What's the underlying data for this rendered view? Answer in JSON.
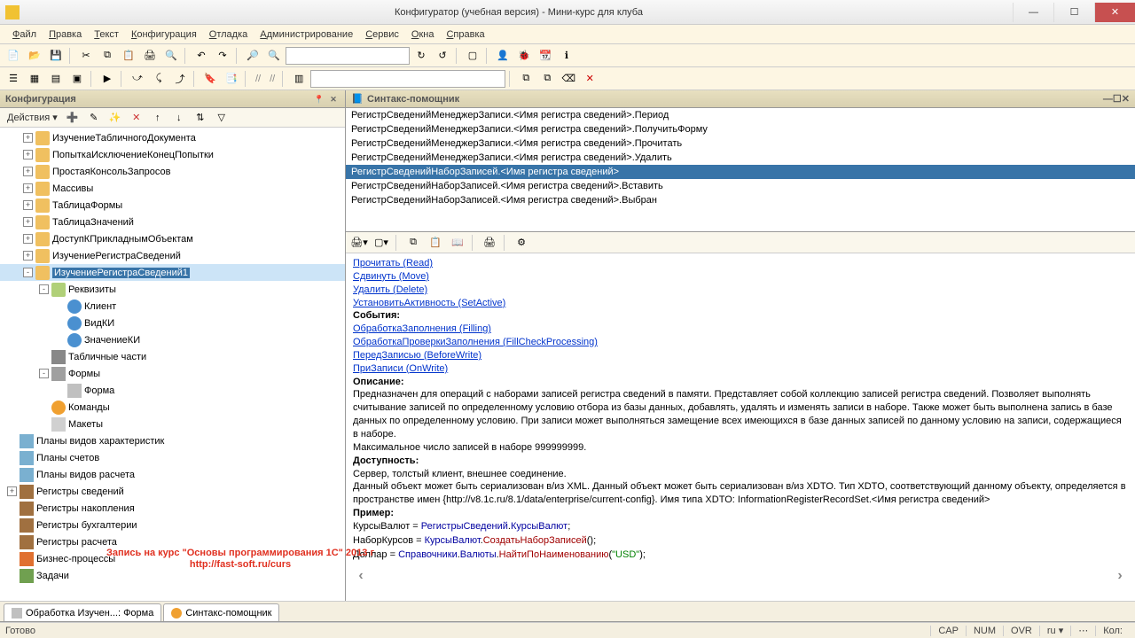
{
  "window": {
    "title": "Конфигуратор (учебная версия) - Мини-курс для клуба"
  },
  "menu": [
    "Файл",
    "Правка",
    "Текст",
    "Конфигурация",
    "Отладка",
    "Администрирование",
    "Сервис",
    "Окна",
    "Справка"
  ],
  "sidebar": {
    "header": "Конфигурация",
    "actions_label": "Действия",
    "tree": [
      {
        "l": 1,
        "exp": "+",
        "ic": "ic-proc",
        "label": "ИзучениеТабличногоДокумента"
      },
      {
        "l": 1,
        "exp": "+",
        "ic": "ic-proc",
        "label": "ПопыткаИсключениеКонецПопытки"
      },
      {
        "l": 1,
        "exp": "+",
        "ic": "ic-proc",
        "label": "ПростаяКонсольЗапросов"
      },
      {
        "l": 1,
        "exp": "+",
        "ic": "ic-proc",
        "label": "Массивы"
      },
      {
        "l": 1,
        "exp": "+",
        "ic": "ic-proc",
        "label": "ТаблицаФормы"
      },
      {
        "l": 1,
        "exp": "+",
        "ic": "ic-proc",
        "label": "ТаблицаЗначений"
      },
      {
        "l": 1,
        "exp": "+",
        "ic": "ic-proc",
        "label": "ДоступКПрикладнымОбъектам"
      },
      {
        "l": 1,
        "exp": "+",
        "ic": "ic-proc",
        "label": "ИзучениеРегистраСведений"
      },
      {
        "l": 1,
        "exp": "-",
        "ic": "ic-proc",
        "label": "ИзучениеРегистраСведений1",
        "sel": true
      },
      {
        "l": 2,
        "exp": "-",
        "ic": "ic-attr",
        "label": "Реквизиты"
      },
      {
        "l": 3,
        "exp": "",
        "ic": "ic-attr-item",
        "label": "Клиент"
      },
      {
        "l": 3,
        "exp": "",
        "ic": "ic-attr-item",
        "label": "ВидКИ"
      },
      {
        "l": 3,
        "exp": "",
        "ic": "ic-attr-item",
        "label": "ЗначениеКИ"
      },
      {
        "l": 2,
        "exp": "",
        "ic": "ic-tab",
        "label": "Табличные части"
      },
      {
        "l": 2,
        "exp": "-",
        "ic": "ic-form",
        "label": "Формы"
      },
      {
        "l": 3,
        "exp": "",
        "ic": "ic-form-item",
        "label": "Форма"
      },
      {
        "l": 2,
        "exp": "",
        "ic": "ic-cmd",
        "label": "Команды"
      },
      {
        "l": 2,
        "exp": "",
        "ic": "ic-tmpl",
        "label": "Макеты"
      },
      {
        "l": 0,
        "exp": "",
        "ic": "ic-plan",
        "label": "Планы видов характеристик"
      },
      {
        "l": 0,
        "exp": "",
        "ic": "ic-plan",
        "label": "Планы счетов"
      },
      {
        "l": 0,
        "exp": "",
        "ic": "ic-plan",
        "label": "Планы видов расчета"
      },
      {
        "l": 0,
        "exp": "+",
        "ic": "ic-reg",
        "label": "Регистры сведений"
      },
      {
        "l": 0,
        "exp": "",
        "ic": "ic-reg",
        "label": "Регистры накопления"
      },
      {
        "l": 0,
        "exp": "",
        "ic": "ic-reg",
        "label": "Регистры бухгалтерии"
      },
      {
        "l": 0,
        "exp": "",
        "ic": "ic-reg",
        "label": "Регистры расчета"
      },
      {
        "l": 0,
        "exp": "",
        "ic": "ic-biz",
        "label": "Бизнес-процессы"
      },
      {
        "l": 0,
        "exp": "",
        "ic": "ic-task",
        "label": "Задачи"
      }
    ]
  },
  "syntax": {
    "header": "Синтакс-помощник",
    "rows": [
      "РегистрСведенийМенеджерЗаписи.<Имя регистра сведений>.Период",
      "РегистрСведенийМенеджерЗаписи.<Имя регистра сведений>.ПолучитьФорму",
      "РегистрСведенийМенеджерЗаписи.<Имя регистра сведений>.Прочитать",
      "РегистрСведенийМенеджерЗаписи.<Имя регистра сведений>.Удалить",
      "РегистрСведенийНаборЗаписей.<Имя регистра сведений>",
      "РегистрСведенийНаборЗаписей.<Имя регистра сведений>.Вставить",
      "РегистрСведенийНаборЗаписей.<Имя регистра сведений>.Выбран"
    ],
    "selected": 4
  },
  "help": {
    "links1": [
      "Прочитать (Read)",
      "Сдвинуть (Move)",
      "Удалить (Delete)",
      "УстановитьАктивность (SetActive)"
    ],
    "events_h": "События:",
    "links2": [
      "ОбработкаЗаполнения (Filling)",
      "ОбработкаПроверкиЗаполнения (FillCheckProcessing)",
      "ПередЗаписью (BeforeWrite)",
      "ПриЗаписи (OnWrite)"
    ],
    "desc_h": "Описание:",
    "desc": "Предназначен для операций с наборами записей регистра сведений в памяти. Представляет собой коллекцию записей регистра сведений. Позволяет выполнять считывание записей по определенному условию отбора из базы данных, добавлять, удалять и изменять записи в наборе. Также может быть выполнена запись в базе данных по определенному условию. При записи может выполняться замещение всех имеющихся в базе данных записей по данному условию на записи, содержащиеся в наборе.",
    "desc2": "Максимальное число записей в наборе 999999999.",
    "avail_h": "Доступность:",
    "avail": "Сервер, толстый клиент, внешнее соединение.",
    "avail2": "Данный объект может быть сериализован в/из XML. Данный объект может быть сериализован в/из XDTO. Тип XDTO, соответствующий данному объекту, определяется в пространстве имен {http://v8.1c.ru/8.1/data/enterprise/current-config}. Имя типа XDTO: InformationRegisterRecordSet.<Имя регистра сведений>",
    "example_h": "Пример:",
    "code": [
      {
        "text": "КурсыВалют ",
        "c": ""
      },
      {
        "text": "=",
        "c": ""
      },
      {
        "text": " РегистрыСведений",
        "c": "c-obj"
      },
      {
        "text": ".",
        "c": ""
      },
      {
        "text": "КурсыВалют",
        "c": "c-obj"
      },
      {
        "text": ";",
        "c": ""
      },
      {
        "text": "\n",
        "c": ""
      },
      {
        "text": "НаборКурсов ",
        "c": ""
      },
      {
        "text": "=",
        "c": ""
      },
      {
        "text": " КурсыВалют",
        "c": "c-obj"
      },
      {
        "text": ".",
        "c": ""
      },
      {
        "text": "СоздатьНаборЗаписей",
        "c": "c-kw"
      },
      {
        "text": "();",
        "c": ""
      },
      {
        "text": "\n",
        "c": ""
      },
      {
        "text": "Доллар ",
        "c": ""
      },
      {
        "text": "=",
        "c": ""
      },
      {
        "text": " Справочники",
        "c": "c-obj"
      },
      {
        "text": ".",
        "c": ""
      },
      {
        "text": "Валюты",
        "c": "c-obj"
      },
      {
        "text": ".",
        "c": ""
      },
      {
        "text": "НайтиПоНаименованию",
        "c": "c-kw"
      },
      {
        "text": "(",
        "c": ""
      },
      {
        "text": "\"USD\"",
        "c": "c-str"
      },
      {
        "text": ");",
        "c": ""
      }
    ]
  },
  "tabs": [
    {
      "label": "Обработка Изучен...: Форма",
      "ic": "ic-form-item"
    },
    {
      "label": "Синтакс-помощник",
      "ic": "ic-cmd"
    }
  ],
  "status": {
    "left": "Готово",
    "cells": [
      "CAP",
      "NUM",
      "OVR",
      "ru ▾",
      "⋯",
      "Кол:"
    ]
  },
  "overlay": {
    "line1": "Запись на курс \"Основы программирования 1С\" 2013 г",
    "line2": "http://fast-soft.ru/curs"
  }
}
